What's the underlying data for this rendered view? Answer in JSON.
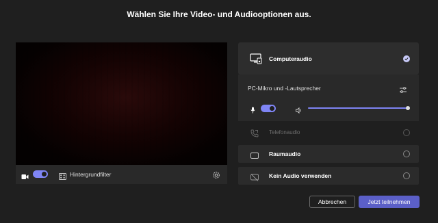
{
  "dialog": {
    "title": "Wählen Sie Ihre Video- und Audiooptionen aus."
  },
  "video": {
    "camera_enabled": true,
    "background_filter_label": "Hintergrundfilter"
  },
  "audio": {
    "options": [
      {
        "label": "Computeraudio",
        "selected": true
      },
      {
        "label": "Telefonaudio",
        "selected": false,
        "disabled": true
      },
      {
        "label": "Raumaudio",
        "selected": false
      },
      {
        "label": "Kein Audio verwenden",
        "selected": false
      }
    ],
    "device_label": "PC-Mikro und -Lautsprecher",
    "mic_enabled": true,
    "volume_level": 1.0
  },
  "buttons": {
    "cancel": "Abbrechen",
    "join": "Jetzt teilnehmen"
  },
  "colors": {
    "accent": "#7f85f5",
    "join_button": "#5b5fc7",
    "background": "#1f1f1f"
  }
}
